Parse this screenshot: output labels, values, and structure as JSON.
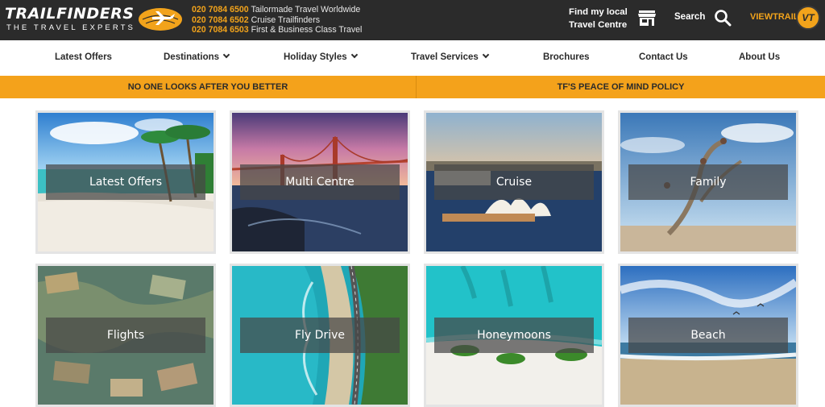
{
  "brand": {
    "name": "TRAILFINDERS",
    "tagline": "THE TRAVEL EXPERTS"
  },
  "phones": [
    {
      "number": "020 7084 6500",
      "label": "Tailormade Travel Worldwide"
    },
    {
      "number": "020 7084 6502",
      "label": "Cruise Trailfinders"
    },
    {
      "number": "020 7084 6503",
      "label": "First & Business Class Travel"
    }
  ],
  "header": {
    "find_local_line1": "Find my local",
    "find_local_line2": "Travel Centre",
    "search_label": "Search",
    "viewtrail_label": "VIEWTRAIL",
    "vt_badge": "VT"
  },
  "nav": {
    "items": [
      {
        "label": "Latest Offers",
        "dropdown": false
      },
      {
        "label": "Destinations",
        "dropdown": true
      },
      {
        "label": "Holiday Styles",
        "dropdown": true
      },
      {
        "label": "Travel Services",
        "dropdown": true
      },
      {
        "label": "Brochures",
        "dropdown": false
      },
      {
        "label": "Contact Us",
        "dropdown": false
      },
      {
        "label": "About Us",
        "dropdown": false
      }
    ]
  },
  "promo": {
    "left": "NO ONE LOOKS AFTER YOU BETTER",
    "right": "TF'S PEACE OF MIND POLICY"
  },
  "tiles": [
    {
      "label": "Latest Offers"
    },
    {
      "label": "Multi Centre"
    },
    {
      "label": "Cruise"
    },
    {
      "label": "Family"
    },
    {
      "label": "Flights"
    },
    {
      "label": "Fly Drive"
    },
    {
      "label": "Honeymoons"
    },
    {
      "label": "Beach"
    }
  ],
  "colors": {
    "brand_orange": "#f4a21b",
    "topbar_bg": "#2b2b2b",
    "nav_text": "#2b2b2b"
  }
}
